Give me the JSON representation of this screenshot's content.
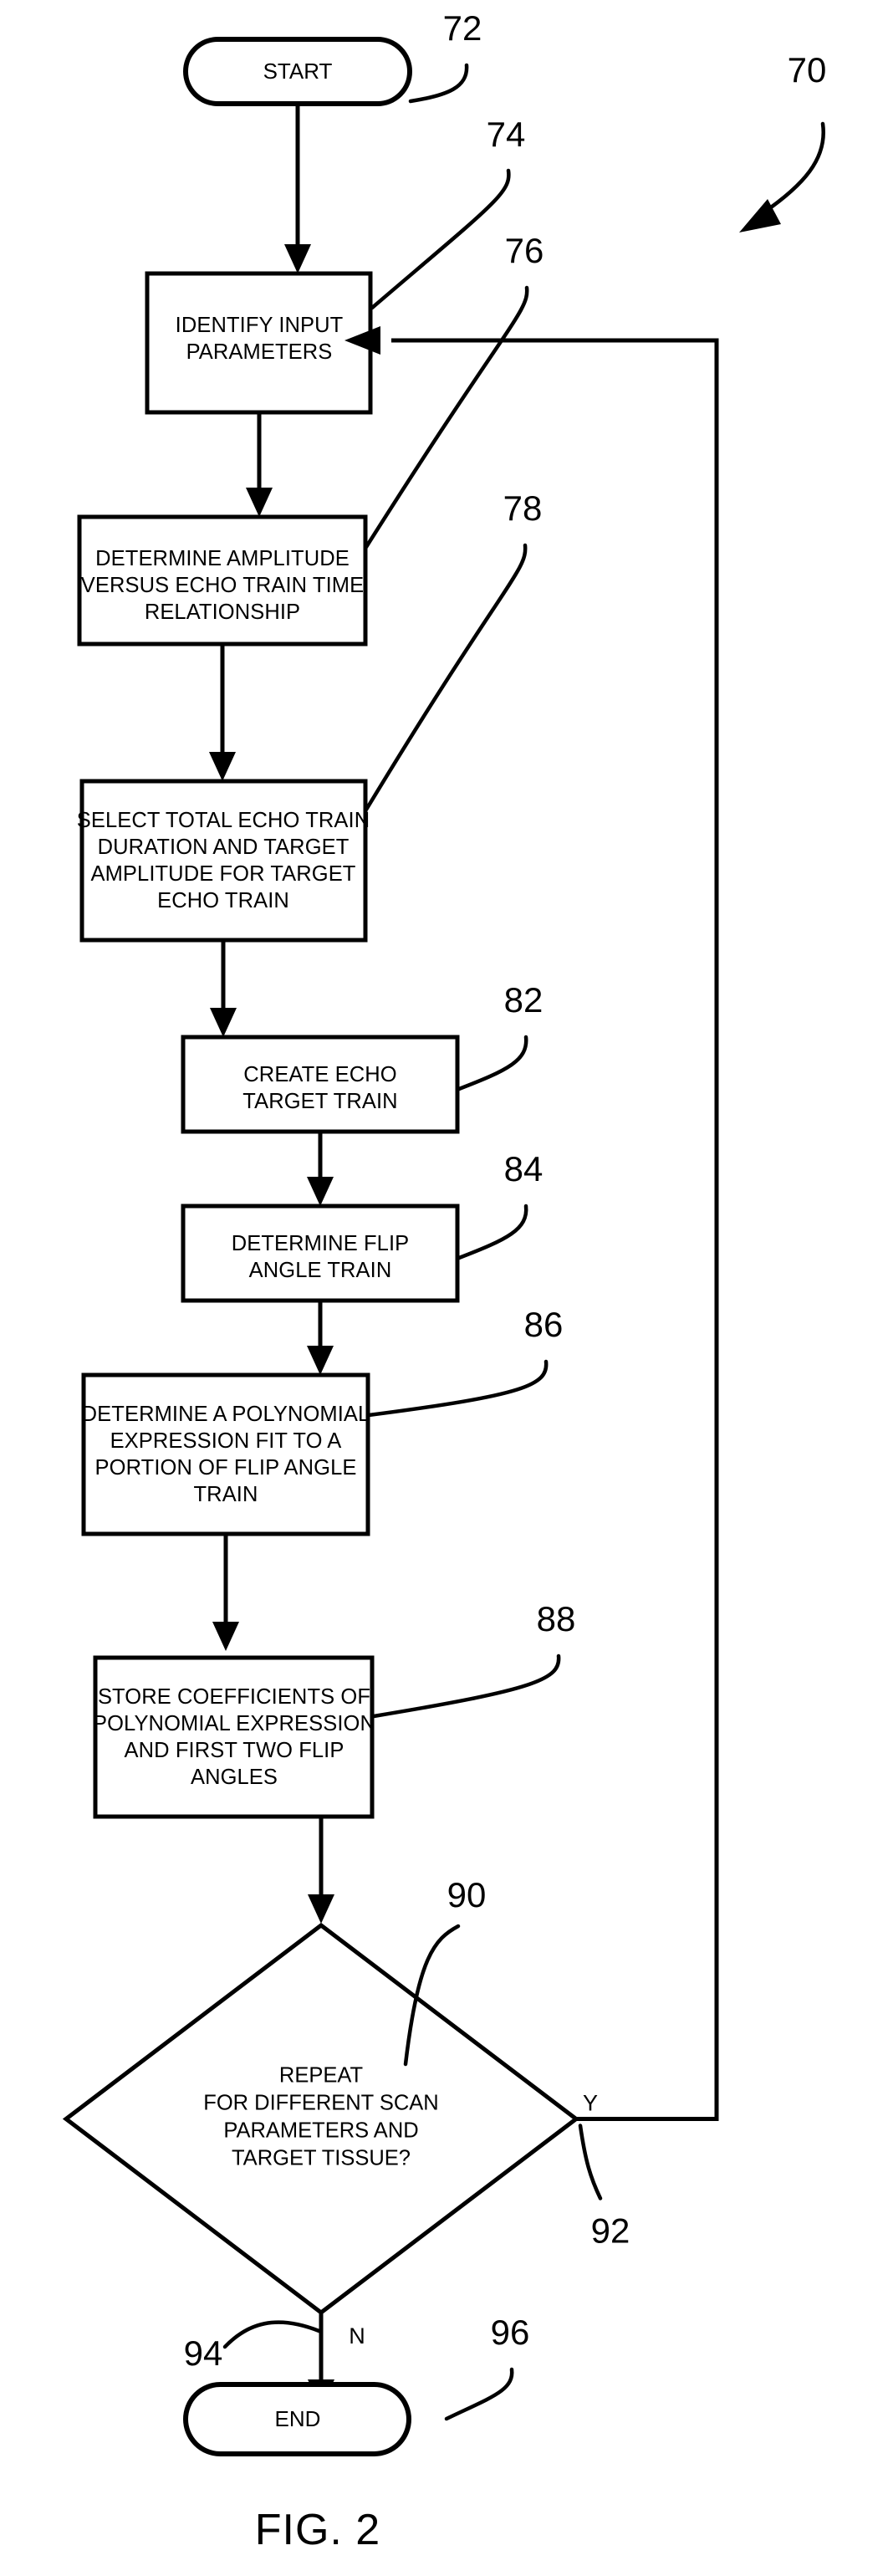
{
  "figure": {
    "caption": "FIG. 2",
    "diagram_reference": "70",
    "type": "patent-flowchart"
  },
  "nodes": [
    {
      "id": "start",
      "ref": "72",
      "shape": "terminator",
      "lines": [
        "START"
      ]
    },
    {
      "id": "identify-input-parameters",
      "ref": "74",
      "shape": "process",
      "lines": [
        "IDENTIFY INPUT",
        "PARAMETERS"
      ]
    },
    {
      "id": "determine-amplitude-relationship",
      "ref": "76",
      "shape": "process",
      "lines": [
        "DETERMINE AMPLITUDE",
        "VERSUS ECHO TRAIN TIME",
        "RELATIONSHIP"
      ]
    },
    {
      "id": "select-total-echo-train",
      "ref": "78",
      "shape": "process",
      "lines": [
        "SELECT TOTAL ECHO TRAIN",
        "DURATION AND TARGET",
        "AMPLITUDE FOR TARGET",
        "ECHO TRAIN"
      ]
    },
    {
      "id": "create-echo-target-train",
      "ref": "82",
      "shape": "process",
      "lines": [
        "CREATE ECHO",
        "TARGET TRAIN"
      ]
    },
    {
      "id": "determine-flip-angle-train",
      "ref": "84",
      "shape": "process",
      "lines": [
        "DETERMINE FLIP",
        "ANGLE TRAIN"
      ]
    },
    {
      "id": "determine-polynomial-fit",
      "ref": "86",
      "shape": "process",
      "lines": [
        "DETERMINE A POLYNOMIAL",
        "EXPRESSION FIT TO A",
        "PORTION OF FLIP ANGLE",
        "TRAIN"
      ]
    },
    {
      "id": "store-coefficients",
      "ref": "88",
      "shape": "process",
      "lines": [
        "STORE COEFFICIENTS OF",
        "POLYNOMIAL EXPRESSION",
        "AND FIRST TWO FLIP",
        "ANGLES"
      ]
    },
    {
      "id": "repeat-decision",
      "ref": "90",
      "shape": "decision",
      "lines": [
        "REPEAT",
        "FOR DIFFERENT SCAN",
        "PARAMETERS AND",
        "TARGET TISSUE?"
      ]
    },
    {
      "id": "end",
      "ref": "96",
      "shape": "terminator",
      "lines": [
        "END"
      ]
    }
  ],
  "branches": {
    "yes_label": "Y",
    "yes_ref": "92",
    "no_label": "N",
    "no_ref": "94"
  },
  "colors": {
    "stroke": "#000000",
    "fill": "#ffffff",
    "background": "#ffffff"
  }
}
